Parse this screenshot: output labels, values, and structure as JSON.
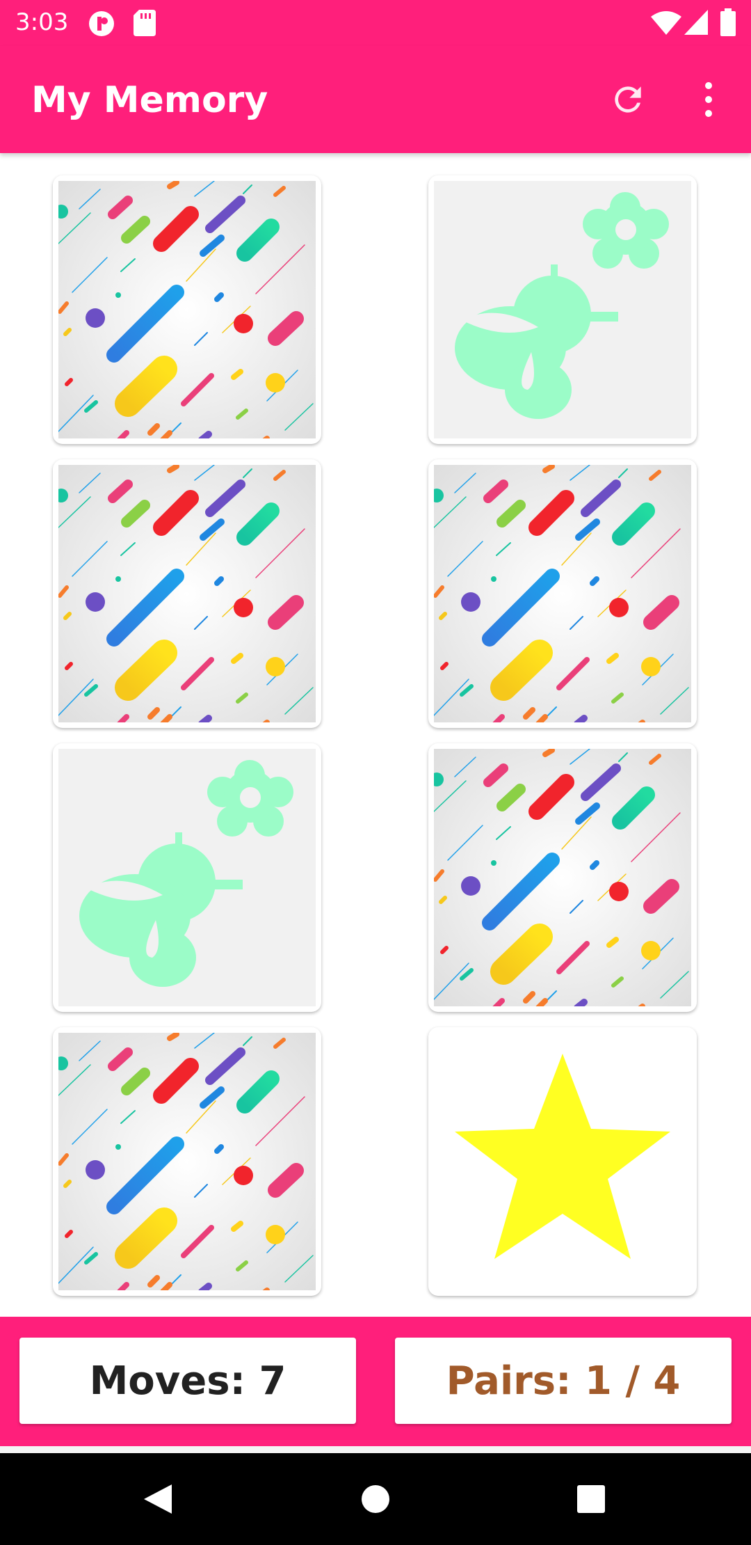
{
  "status_bar": {
    "time": "3:03"
  },
  "app_bar": {
    "title": "My Memory"
  },
  "stats": {
    "moves_label": "Moves: 7",
    "pairs_label": "Pairs: 1 / 4"
  },
  "cards": [
    {
      "state": "face-down",
      "image": "confetti-pattern"
    },
    {
      "state": "matched",
      "image": "bee-flower"
    },
    {
      "state": "face-down",
      "image": "confetti-pattern"
    },
    {
      "state": "face-down",
      "image": "confetti-pattern"
    },
    {
      "state": "matched",
      "image": "bee-flower"
    },
    {
      "state": "face-down",
      "image": "confetti-pattern"
    },
    {
      "state": "face-down",
      "image": "confetti-pattern"
    },
    {
      "state": "face-up",
      "image": "star"
    }
  ],
  "colors": {
    "primary": "#ff1f7b",
    "matched_icon": "#9bfcc8",
    "star": "#ffff22",
    "pairs_text": "#a15a2a",
    "moves_text": "#212121"
  },
  "icons": {
    "refresh": "refresh-icon",
    "overflow": "more-vert-icon",
    "back": "back-triangle-icon",
    "home": "home-circle-icon",
    "recents": "recents-square-icon"
  }
}
